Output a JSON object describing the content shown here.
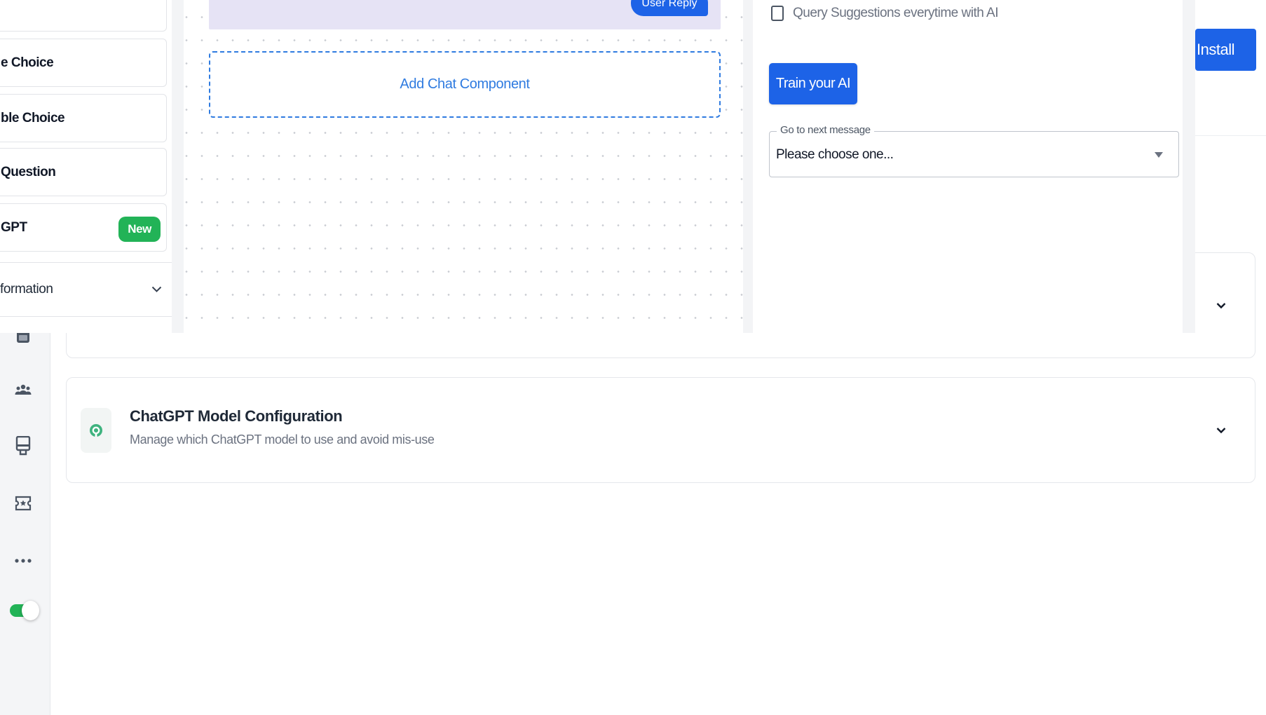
{
  "palette": {
    "items": [
      {
        "label": "e Choice"
      },
      {
        "label": "ble Choice"
      },
      {
        "label": "Question"
      },
      {
        "label": "GPT",
        "badge": "New"
      }
    ],
    "section_label": "formation"
  },
  "canvas": {
    "reply_label": "User Reply",
    "add_component_label": "Add Chat Component"
  },
  "settings": {
    "query_suggestions_label": "Query Suggestions everytime with AI",
    "query_suggestions_checked": false,
    "train_button_label": "Train your AI",
    "next_message": {
      "legend": "Go to next message",
      "value": "Please choose one..."
    }
  },
  "header": {
    "install_label": "Install"
  },
  "sections": [
    {
      "title": "ChatGPT Model Configuration",
      "subtitle": "Manage which ChatGPT model to use and avoid mis-use",
      "icon": "openai-icon"
    }
  ],
  "rail": {
    "icons": [
      "calendar-icon",
      "team-icon",
      "kiosk-icon",
      "ticket-star-icon",
      "more-icon"
    ],
    "toggle_on": true
  },
  "colors": {
    "primary": "#1d63e7",
    "success": "#22b357",
    "dashed_accent": "#2f7be0",
    "message_bg": "#e6e3f5"
  }
}
